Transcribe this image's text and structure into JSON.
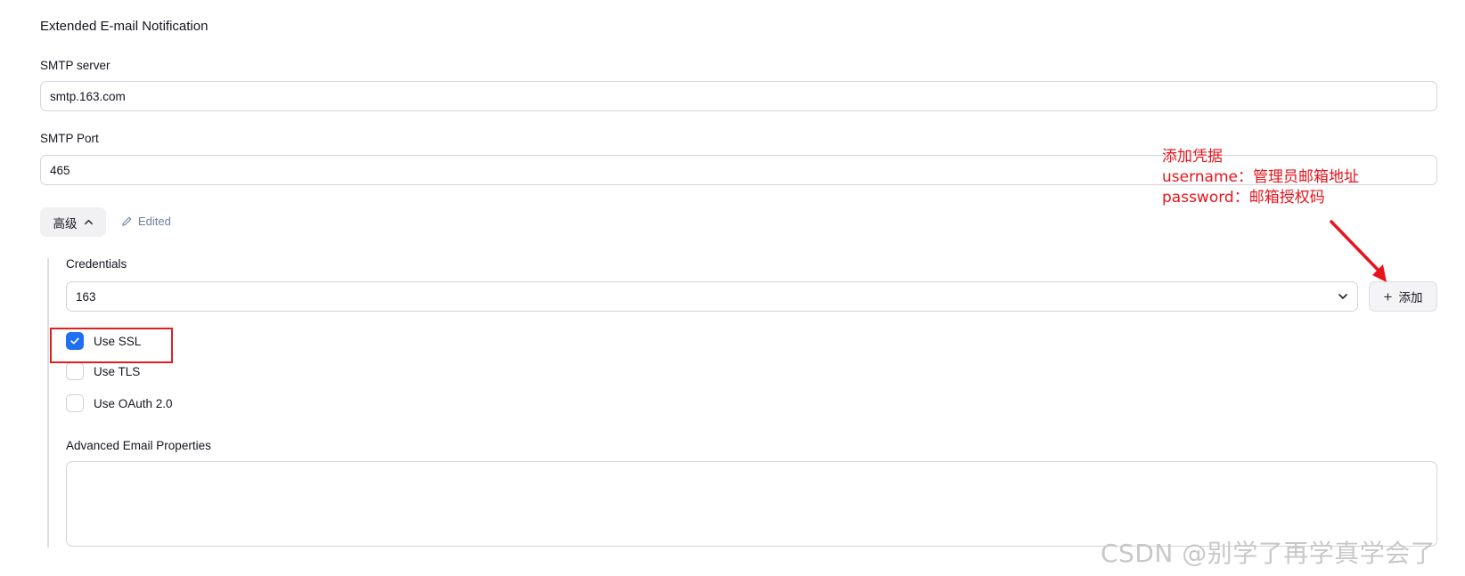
{
  "section": {
    "title": "Extended E-mail Notification"
  },
  "smtp_server": {
    "label": "SMTP server",
    "value": "smtp.163.com"
  },
  "smtp_port": {
    "label": "SMTP Port",
    "value": "465"
  },
  "advanced": {
    "button_label": "高级",
    "button_icon": "chevron-up-icon",
    "edited_label": "Edited",
    "edited_icon": "pencil-icon"
  },
  "credentials": {
    "label": "Credentials",
    "selected": "163",
    "dropdown_icon": "chevron-down-icon",
    "add_label": "添加",
    "add_icon": "plus-icon"
  },
  "options": [
    {
      "label": "Use SSL",
      "checked": true
    },
    {
      "label": "Use TLS",
      "checked": false
    },
    {
      "label": "Use OAuth 2.0",
      "checked": false
    }
  ],
  "advanced_email_properties": {
    "label": "Advanced Email Properties",
    "value": ""
  },
  "annotation": {
    "lines": [
      "添加凭据",
      "username：管理员邮箱地址",
      "password：邮箱授权码"
    ],
    "color": "#e8141c"
  },
  "watermark": "CSDN @别学了再学真学会了",
  "colors": {
    "accent": "#1e6ff2",
    "annotation_red": "#e02020",
    "edited_text": "#6a7fa0"
  }
}
